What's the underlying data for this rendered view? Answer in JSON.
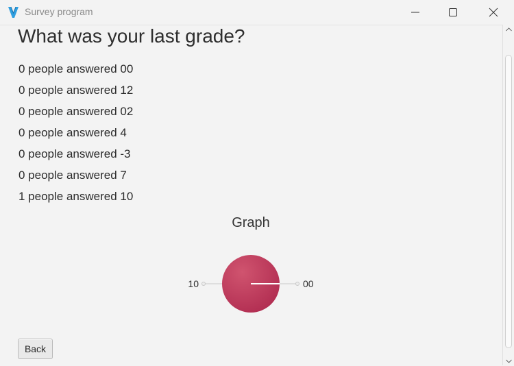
{
  "window": {
    "title": "Survey program",
    "minimize_icon": "minimize-icon",
    "maximize_icon": "maximize-icon",
    "close_icon": "close-icon"
  },
  "question": "What was your last grade?",
  "answers": [
    "0 people answered 00",
    "0 people answered 12",
    "0 people answered 02",
    "0 people answered 4",
    "0 people answered -3",
    "0 people answered 7",
    "1 people answered 10"
  ],
  "graph": {
    "title": "Graph"
  },
  "chart_data": {
    "type": "pie",
    "title": "Graph",
    "slices": [
      {
        "label": "10",
        "value": 1
      },
      {
        "label": "00",
        "value": 0
      }
    ],
    "colors": [
      "#c23a5c"
    ]
  },
  "back_button": {
    "label": "Back"
  },
  "colors": {
    "background": "#f3f3f3",
    "pie_slice": "#c23a5c",
    "app_icon": "#2f9fe0"
  }
}
